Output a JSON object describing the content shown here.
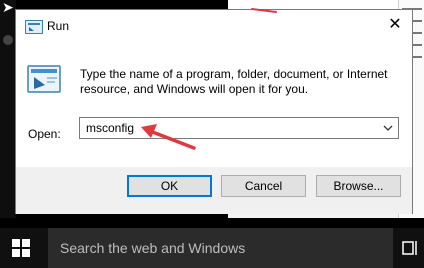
{
  "dialog": {
    "title": "Run",
    "description": "Type the name of a program, folder, document, or Internet resource, and Windows will open it for you.",
    "open_label": "Open:",
    "open_value": "msconfig",
    "buttons": {
      "ok": "OK",
      "cancel": "Cancel",
      "browse": "Browse..."
    },
    "close_glyph": "✕",
    "icons": {
      "title": "run-icon",
      "content": "run-icon",
      "dropdown": "chevron-down-icon",
      "close": "close-icon"
    }
  },
  "annotation": {
    "arrow_color": "#e0393e"
  },
  "taskbar": {
    "search_placeholder": "Search the web and Windows",
    "icons": {
      "start": "windows-logo-icon",
      "task_view": "task-view-icon"
    }
  },
  "colors": {
    "accent": "#0078d7",
    "taskbar": "#101010",
    "search_box": "#2b2b2b"
  }
}
